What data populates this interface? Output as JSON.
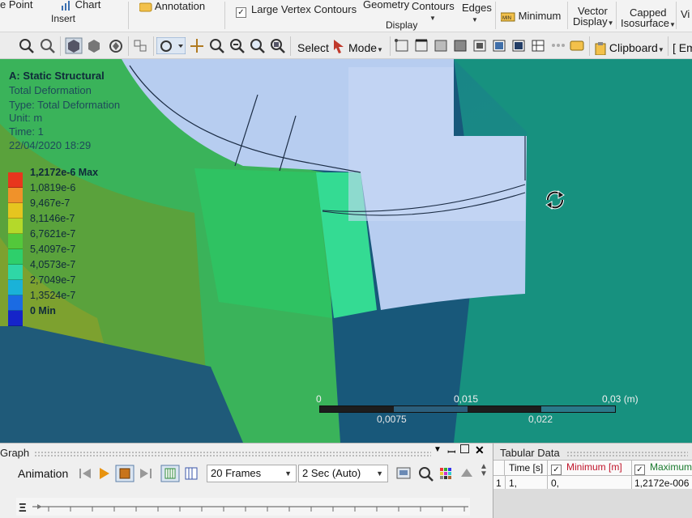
{
  "ribbon": {
    "point_label": "e Point",
    "chart_label": "Chart",
    "insert_label": "Insert",
    "annotation_label": "Annotation",
    "large_vertex_contours_label": "Large Vertex Contours",
    "geometry_label": "Geometry",
    "contours_label": "Contours",
    "edges_label": "Edges",
    "display_label": "Display",
    "minimum_label": "Minimum",
    "vector_display_label_1": "Vector",
    "vector_display_label_2": "Display",
    "capped_isosurface_label_1": "Capped",
    "capped_isosurface_label_2": "Isosurface",
    "cut_label": "Vi"
  },
  "toolbar": {
    "select_label": "Select",
    "mode_label": "Mode",
    "clipboard_label": "Clipboard",
    "cut_label": "[ Em"
  },
  "legend": {
    "title": "A: Static Structural",
    "result": "Total Deformation",
    "type": "Type: Total Deformation",
    "unit": "Unit: m",
    "time": "Time: 1",
    "date": "22/04/2020 18:29",
    "levels": [
      {
        "label": "1,2172e-6 Max",
        "color": "#e8361d"
      },
      {
        "label": "1,0819e-6",
        "color": "#f0922a"
      },
      {
        "label": "9,467e-7",
        "color": "#e6c51f"
      },
      {
        "label": "8,1146e-7",
        "color": "#b4d92a"
      },
      {
        "label": "6,7621e-7",
        "color": "#53c83b"
      },
      {
        "label": "5,4097e-7",
        "color": "#2ecf6b"
      },
      {
        "label": "4,0573e-7",
        "color": "#2fd7a6"
      },
      {
        "label": "2,7049e-7",
        "color": "#1ab2d8"
      },
      {
        "label": "1,3524e-7",
        "color": "#1b6be3"
      },
      {
        "label": "0 Min",
        "color": "#1524c9"
      }
    ]
  },
  "scale_bar": {
    "top_labels": [
      "0",
      "0,015",
      "0,03 (m)"
    ],
    "bottom_labels": [
      "0,0075",
      "0,022"
    ]
  },
  "graph": {
    "title": "Graph",
    "animation_label": "Animation",
    "frames_value": "20 Frames",
    "duration_value": "2 Sec (Auto)"
  },
  "tabular": {
    "title": "Tabular Data",
    "columns": [
      "Time [s]",
      "Minimum [m]",
      "Maximum"
    ],
    "rows": [
      {
        "index": "1",
        "time": "1,",
        "minimum": "0,",
        "maximum": "1,2172e-006"
      }
    ]
  }
}
